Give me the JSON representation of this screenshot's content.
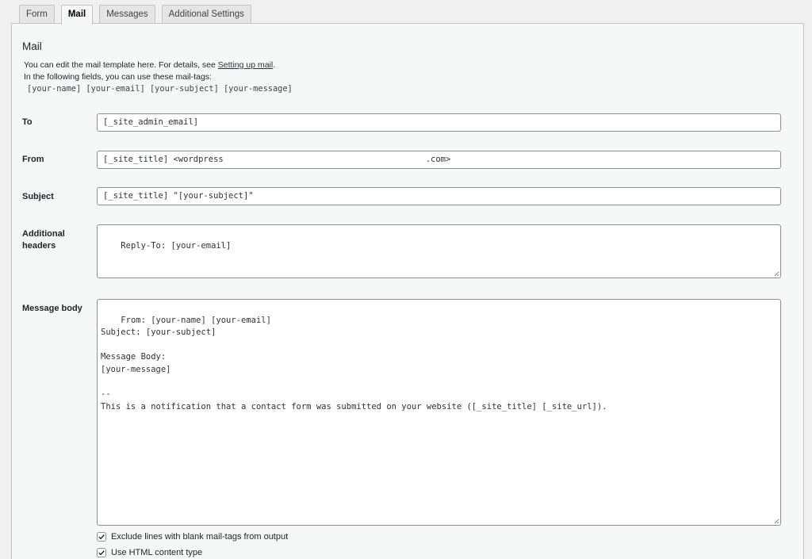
{
  "tabs": [
    {
      "label": "Form",
      "active": false
    },
    {
      "label": "Mail",
      "active": true
    },
    {
      "label": "Messages",
      "active": false
    },
    {
      "label": "Additional Settings",
      "active": false
    }
  ],
  "mail": {
    "heading": "Mail",
    "desc_prefix": "You can edit the mail template here. For details, see ",
    "desc_link": "Setting up mail",
    "desc_suffix": ".",
    "desc2": "In the following fields, you can use these mail-tags:",
    "tags": "[your-name] [your-email] [your-subject] [your-message]"
  },
  "fields": {
    "to": {
      "label": "To",
      "value": "[_site_admin_email]"
    },
    "from": {
      "label": "From",
      "value_start": "[_site_title] <wordpress",
      "value_end": ".com>"
    },
    "subject": {
      "label": "Subject",
      "value": "[_site_title] \"[your-subject]\""
    },
    "headers": {
      "label": "Additional headers",
      "value": "Reply-To: [your-email]"
    },
    "body": {
      "label": "Message body",
      "value": "From: [your-name] [your-email]\nSubject: [your-subject]\n\nMessage Body:\n[your-message]\n\n--\nThis is a notification that a contact form was submitted on your website ([_site_title] [_site_url])."
    }
  },
  "options": {
    "exclude_blank": {
      "label": "Exclude lines with blank mail-tags from output",
      "checked": true
    },
    "html_content": {
      "label": "Use HTML content type",
      "checked": true
    }
  },
  "icons": {
    "check": "checkmark-icon",
    "resize": "resize-grip-icon"
  }
}
